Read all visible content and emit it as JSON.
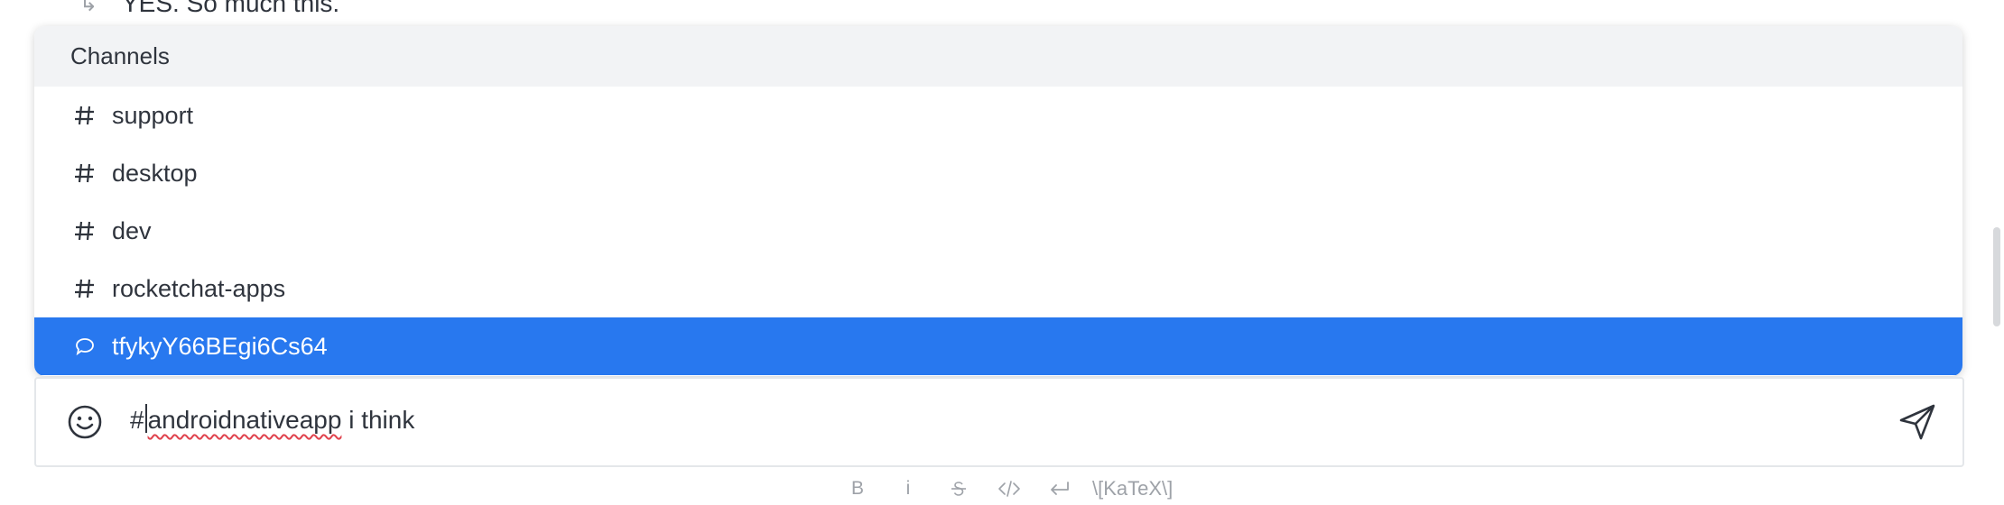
{
  "background_message": {
    "text": "YES. So much this."
  },
  "popup": {
    "title": "Channels",
    "items": [
      {
        "label": "support",
        "icon": "hash-icon"
      },
      {
        "label": "desktop",
        "icon": "hash-icon"
      },
      {
        "label": "dev",
        "icon": "hash-icon"
      },
      {
        "label": "rocketchat-apps",
        "icon": "hash-icon"
      },
      {
        "label": "tfykyY66BEgi6Cs64",
        "icon": "discussion-icon",
        "selected": true
      }
    ]
  },
  "composer": {
    "prefix": "#",
    "misspelled_word": "androidnativeapp",
    "rest": " i think"
  },
  "toolbar": {
    "bold_label": "B",
    "italic_label": "i",
    "katex_label": "\\[KaTeX\\]"
  },
  "colors": {
    "accent": "#2878ef",
    "header_bg": "#f2f3f5",
    "text": "#2f343d",
    "muted": "#9ea2a8"
  }
}
